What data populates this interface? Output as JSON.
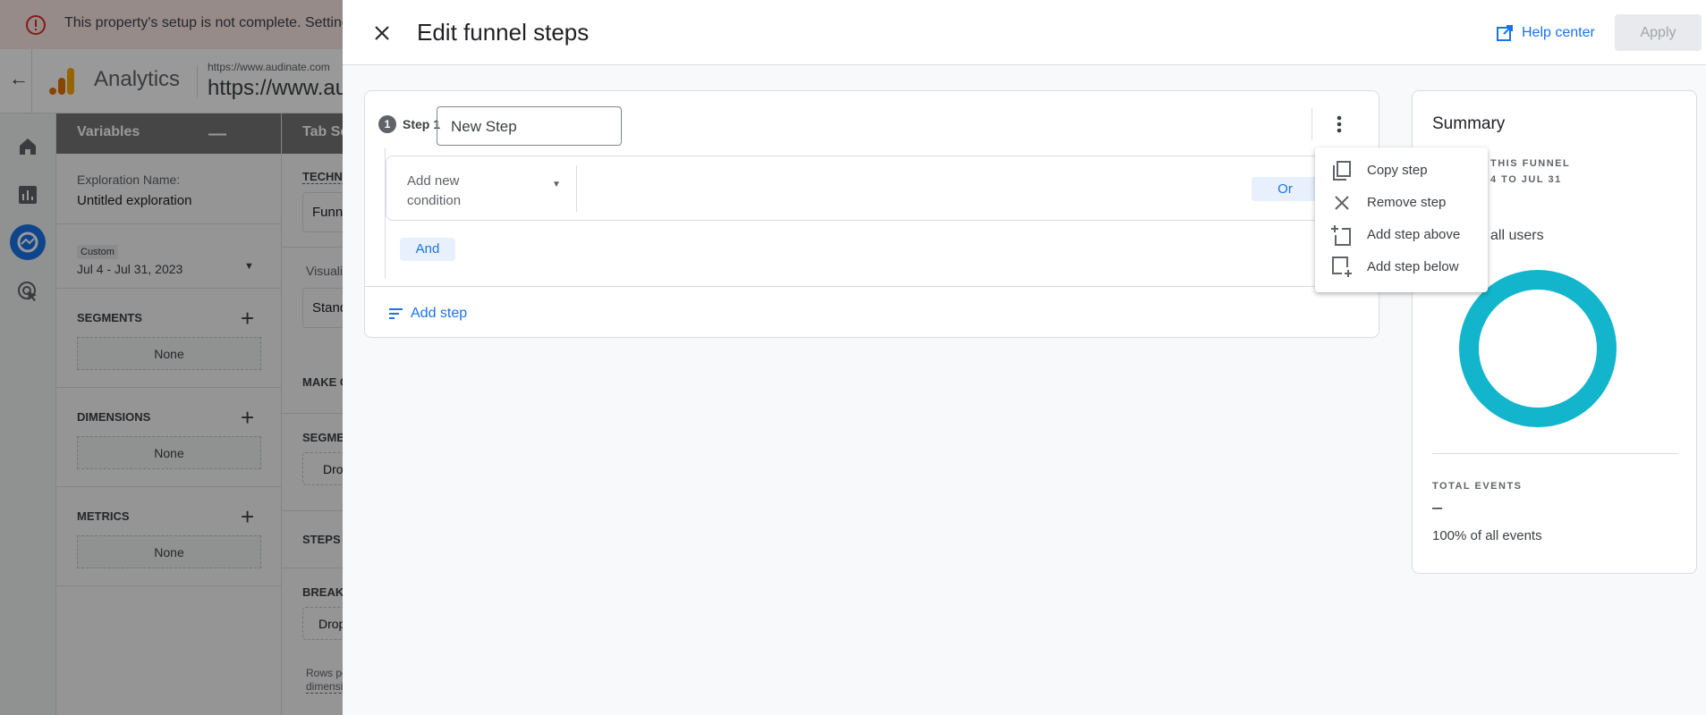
{
  "banner": {
    "text": "This property's setup is not complete. Settings",
    "icon": "error-icon"
  },
  "topbar": {
    "app_name": "Analytics",
    "property_small": "https://www.audinate.com",
    "property_large": "https://www.audinate.com"
  },
  "variables": {
    "title": "Variables",
    "exploration_label": "Exploration Name:",
    "exploration_name": "Untitled exploration",
    "date_chip": "Custom",
    "date_range": "Jul 4 - Jul 31, 2023",
    "segments": "SEGMENTS",
    "dimensions": "DIMENSIONS",
    "metrics": "METRICS",
    "none": "None"
  },
  "tab_settings": {
    "title": "Tab Settings",
    "technique": "TECHNIQUE",
    "technique_value": "Funnel exploration",
    "visualization": "Visualization",
    "visualization_value": "Standard funnel",
    "make_open": "MAKE OPEN FUNNEL",
    "segment_comparisons": "SEGMENT COMPARISONS",
    "drop_segment": "Drop or select segment",
    "steps": "STEPS",
    "breakdown": "BREAKDOWN",
    "drop_dimension": "Drop or select dimension",
    "rows_line1": "Rows per",
    "rows_line2": "dimension"
  },
  "panel": {
    "title": "Edit funnel steps",
    "help_center": "Help center",
    "apply": "Apply"
  },
  "step": {
    "number": "1",
    "label": "Step 1",
    "name_value": "New Step",
    "condition_placeholder_1": "Add new",
    "condition_placeholder_2": "condition",
    "or": "Or",
    "and": "And",
    "add_step": "Add step"
  },
  "menu": {
    "items": [
      {
        "label": "Copy step",
        "icon": "copy-icon"
      },
      {
        "label": "Remove step",
        "icon": "close-icon"
      },
      {
        "label": "Add step above",
        "icon": "add-above-icon"
      },
      {
        "label": "Add step below",
        "icon": "add-below-icon"
      }
    ]
  },
  "summary": {
    "title": "Summary",
    "funnel_label": "THIS FUNNEL",
    "funnel_dates": "4 TO JUL 31",
    "users_pct": "all users",
    "total_events_label": "TOTAL EVENTS",
    "total_events_value": "–",
    "events_pct": "100% of all events",
    "donut_color": "#12b5cb",
    "donut_fill_percent": 100
  },
  "colors": {
    "accent": "#1a73e8",
    "error": "#d93025"
  }
}
